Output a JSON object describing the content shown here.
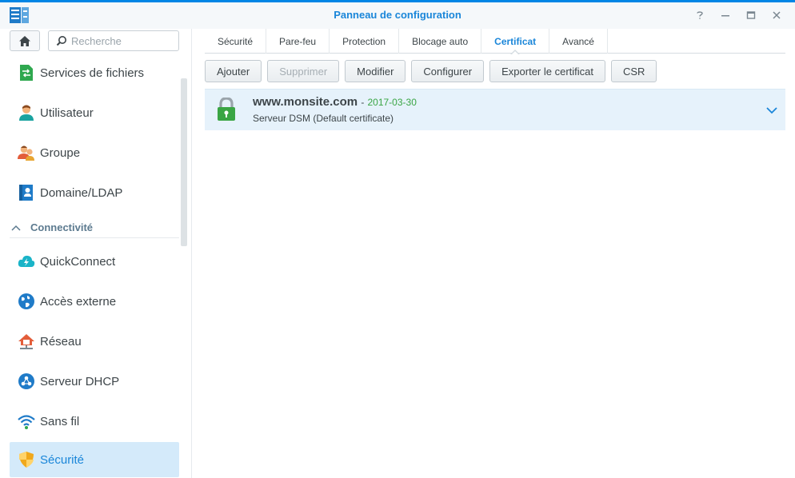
{
  "window": {
    "title": "Panneau de configuration",
    "controls": [
      "help-icon",
      "minimize-icon",
      "maximize-icon",
      "close-icon"
    ]
  },
  "sidebar": {
    "search": {
      "placeholder": "Recherche",
      "value": ""
    },
    "items": [
      {
        "label": "Services de fichiers",
        "icon": "file-services-icon"
      },
      {
        "label": "Utilisateur",
        "icon": "user-icon"
      },
      {
        "label": "Groupe",
        "icon": "group-icon"
      },
      {
        "label": "Domaine/LDAP",
        "icon": "domain-icon"
      }
    ],
    "section": {
      "label": "Connectivité"
    },
    "connectivity_items": [
      {
        "label": "QuickConnect",
        "icon": "quickconnect-icon"
      },
      {
        "label": "Accès externe",
        "icon": "external-access-icon"
      },
      {
        "label": "Réseau",
        "icon": "network-icon"
      },
      {
        "label": "Serveur DHCP",
        "icon": "dhcp-icon"
      },
      {
        "label": "Sans fil",
        "icon": "wifi-icon"
      },
      {
        "label": "Sécurité",
        "icon": "security-shield-icon",
        "active": true
      }
    ]
  },
  "tabs": [
    {
      "label": "Sécurité"
    },
    {
      "label": "Pare-feu"
    },
    {
      "label": "Protection"
    },
    {
      "label": "Blocage auto"
    },
    {
      "label": "Certificat",
      "active": true
    },
    {
      "label": "Avancé"
    }
  ],
  "toolbar": {
    "add": "Ajouter",
    "delete": "Supprimer",
    "edit": "Modifier",
    "configure": "Configurer",
    "export": "Exporter le certificat",
    "csr": "CSR"
  },
  "certificate": {
    "domain": "www.monsite.com",
    "separator": "-",
    "date": "2017-03-30",
    "description": "Serveur DSM (Default certificate)"
  },
  "colors": {
    "accent": "#1a86d9",
    "active_bg": "#d4eafa",
    "row_bg": "#e6f2fb",
    "lock_green": "#3aa544"
  }
}
